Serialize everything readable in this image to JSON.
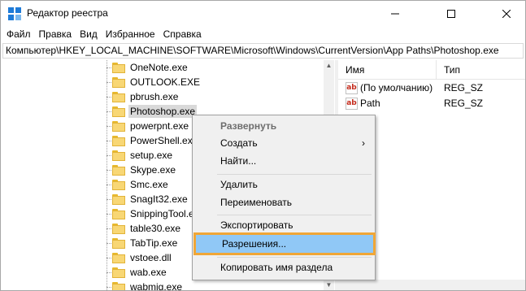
{
  "window": {
    "title": "Редактор реестра",
    "accent_color": "#1e7bd8"
  },
  "menu": {
    "items": [
      "Файл",
      "Правка",
      "Вид",
      "Избранное",
      "Справка"
    ]
  },
  "address": {
    "path": "Компьютер\\HKEY_LOCAL_MACHINE\\SOFTWARE\\Microsoft\\Windows\\CurrentVersion\\App Paths\\Photoshop.exe"
  },
  "tree": {
    "items": [
      "OneNote.exe",
      "OUTLOOK.EXE",
      "pbrush.exe",
      "Photoshop.exe",
      "powerpnt.exe",
      "PowerShell.exe",
      "setup.exe",
      "Skype.exe",
      "Smc.exe",
      "SnagIt32.exe",
      "SnippingTool.exe",
      "table30.exe",
      "TabTip.exe",
      "vstoee.dll",
      "wab.exe",
      "wabmig.exe"
    ],
    "selected": "Photoshop.exe"
  },
  "list": {
    "columns": {
      "name": "Имя",
      "type": "Тип"
    },
    "rows": [
      {
        "icon": "ab",
        "name": "(По умолчанию)",
        "type": "REG_SZ"
      },
      {
        "icon": "ab",
        "name": "Path",
        "type": "REG_SZ"
      }
    ]
  },
  "context_menu": {
    "expand": "Развернуть",
    "create": "Создать",
    "find": "Найти...",
    "delete": "Удалить",
    "rename": "Переименовать",
    "export": "Экспортировать",
    "permissions": "Разрешения...",
    "copy_key_name": "Копировать имя раздела",
    "highlight_color": "#f0a637",
    "hover_color": "#90c8f6"
  }
}
